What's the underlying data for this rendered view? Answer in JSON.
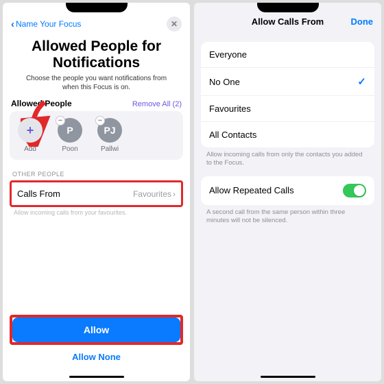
{
  "left": {
    "back": "Name Your Focus",
    "title": "Allowed People for Notifications",
    "subtitle": "Choose the people you want notifications from when this Focus is on.",
    "section_allowed": "Allowed People",
    "remove_all": "Remove All (2)",
    "add_label": "Add",
    "people": [
      {
        "initial": "P",
        "name": "Poon"
      },
      {
        "initial": "PJ",
        "name": "Pallwi"
      }
    ],
    "other_label": "OTHER PEOPLE",
    "calls_from": "Calls From",
    "calls_value": "Favourites",
    "calls_helper": "Allow incoming calls from your favourites.",
    "allow_btn": "Allow",
    "allow_none": "Allow None"
  },
  "right": {
    "title": "Allow Calls From",
    "done": "Done",
    "options": [
      {
        "label": "Everyone",
        "checked": false
      },
      {
        "label": "No One",
        "checked": true
      },
      {
        "label": "Favourites",
        "checked": false
      },
      {
        "label": "All Contacts",
        "checked": false
      }
    ],
    "options_helper": "Allow incoming calls from only the contacts you added to the Focus.",
    "repeated_label": "Allow Repeated Calls",
    "repeated_helper": "A second call from the same person within three minutes will not be silenced."
  }
}
